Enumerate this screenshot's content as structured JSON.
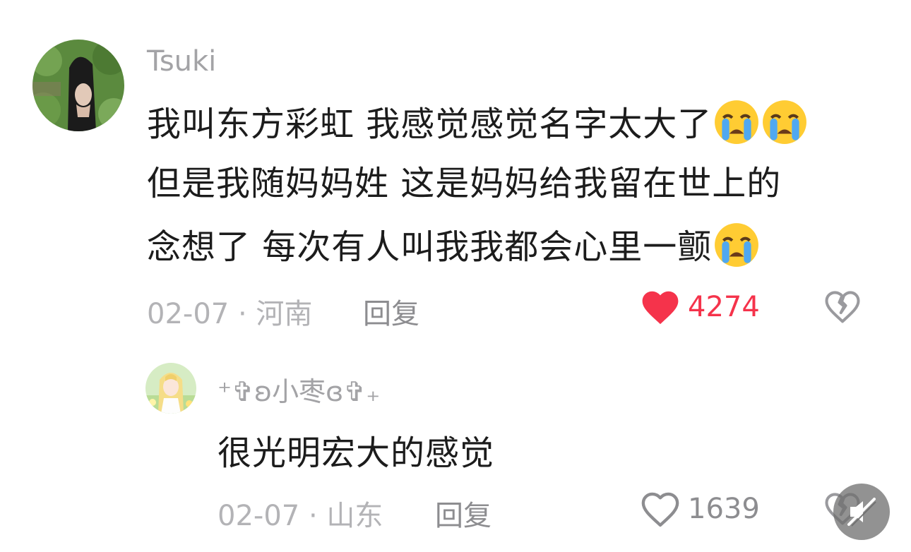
{
  "main_comment": {
    "username": "Tsuki",
    "lines": [
      "我叫东方彩虹 我感觉感觉名字太大了",
      "但是我随妈妈姓 这是妈妈给我留在世上的",
      "念想了 每次有人叫我我都会心里一颤"
    ],
    "emojis": [
      "loudly-crying-face",
      "loudly-crying-face",
      "loudly-crying-face"
    ],
    "date": "02-07",
    "separator": "·",
    "location": "河南",
    "reply_label": "回复",
    "like_count": "4274",
    "liked": true,
    "like_color": "#f5334b"
  },
  "reply_comment": {
    "username": "⁺✞ʚ小枣ɞ✞₊",
    "text": "很光明宏大的感觉",
    "date": "02-07",
    "separator": "·",
    "location": "山东",
    "reply_label": "回复",
    "like_count": "1639",
    "liked": false
  },
  "overlay": {
    "icon": "mute-speaker-icon"
  }
}
